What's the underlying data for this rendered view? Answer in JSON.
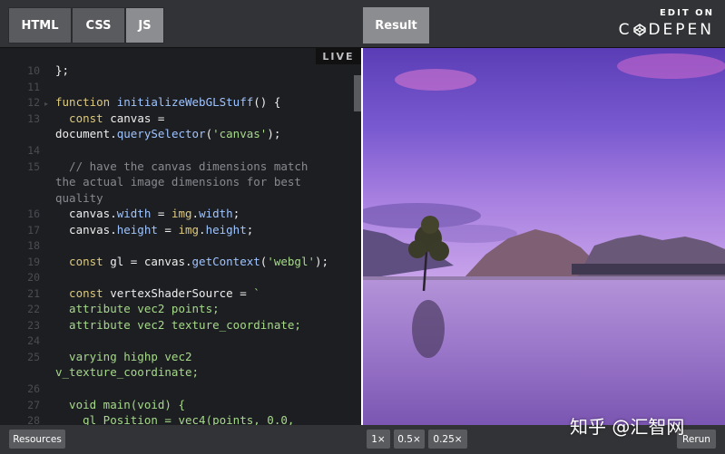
{
  "tabs": [
    {
      "label": "HTML",
      "active": false
    },
    {
      "label": "CSS",
      "active": false
    },
    {
      "label": "JS",
      "active": true
    }
  ],
  "result_tab": "Result",
  "brand": {
    "line1": "EDIT ON",
    "line2_a": "C",
    "line2_b": "DEPEN"
  },
  "live_badge": "LIVE",
  "line_numbers": [
    "10",
    "11",
    "12",
    "13",
    "",
    "14",
    "15",
    "",
    "",
    "16",
    "17",
    "18",
    "19",
    "20",
    "21",
    "22",
    "23",
    "24",
    "25",
    "",
    "26",
    "27",
    "28"
  ],
  "code_lines": [
    "};",
    "",
    "function initializeWebGLStuff() {",
    "  const canvas =",
    "document.querySelector('canvas');",
    "",
    "  // have the canvas dimensions match",
    "the actual image dimensions for best",
    "quality",
    "  canvas.width = img.width;",
    "  canvas.height = img.height;",
    "",
    "  const gl = canvas.getContext('webgl');",
    "",
    "  const vertexShaderSource = `",
    "  attribute vec2 points;",
    "  attribute vec2 texture_coordinate;",
    "",
    "  varying highp vec2",
    "v_texture_coordinate;",
    "",
    "  void main(void) {",
    "    gl_Position = vec4(points, 0.0,"
  ],
  "bottom": {
    "resources": "Resources",
    "zoom": [
      "1×",
      "0.5×",
      "0.25×"
    ],
    "rerun": "Rerun"
  },
  "watermark": "知乎 @汇智网",
  "colors": {
    "accent_keyword": "#ddca7e",
    "function": "#9ec4ff",
    "string": "#a6d98a",
    "comment": "#88898f"
  }
}
